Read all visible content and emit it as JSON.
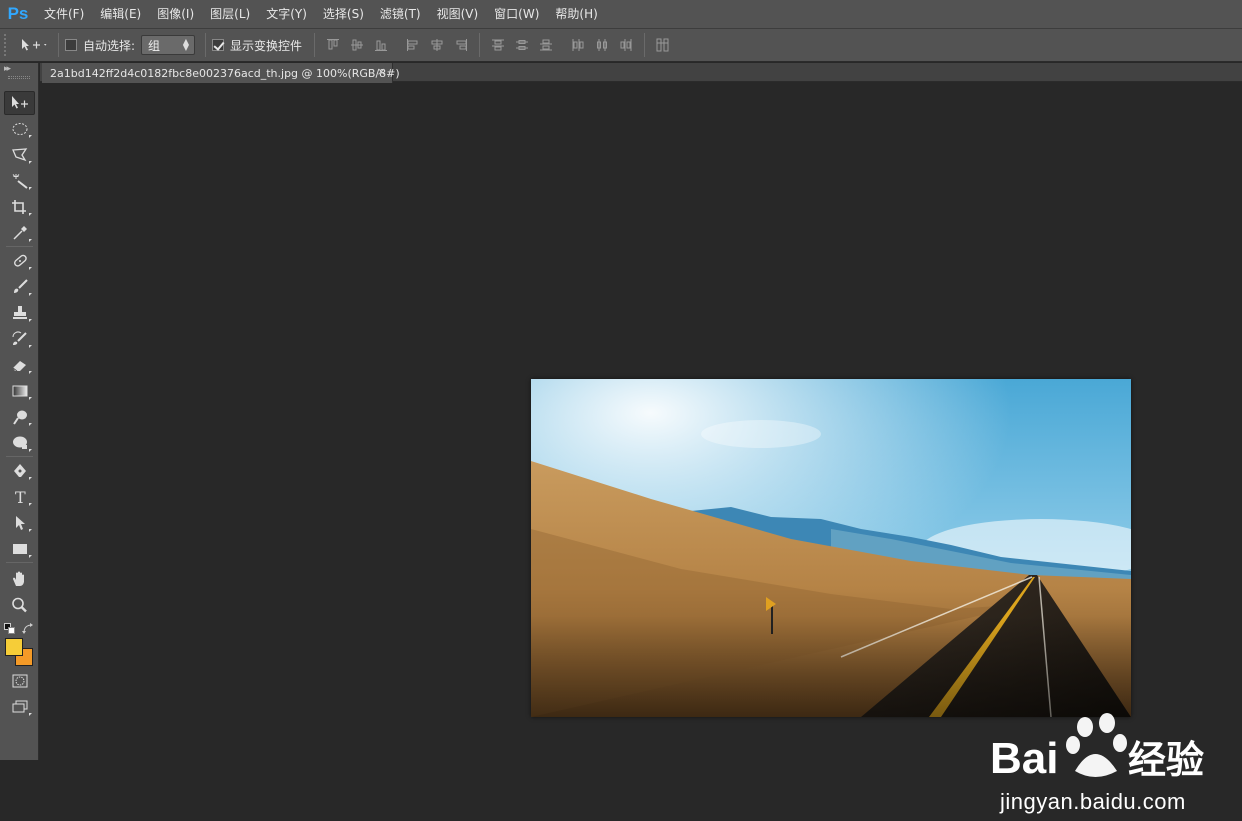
{
  "app": {
    "logo_text": "Ps",
    "accent": "#31a8ff"
  },
  "menu": {
    "items": [
      "文件(F)",
      "编辑(E)",
      "图像(I)",
      "图层(L)",
      "文字(Y)",
      "选择(S)",
      "滤镜(T)",
      "视图(V)",
      "窗口(W)",
      "帮助(H)"
    ]
  },
  "options": {
    "auto_select_label": "自动选择:",
    "auto_select_checked": false,
    "group_value": "组",
    "show_transform_label": "显示变换控件",
    "show_transform_checked": true
  },
  "document": {
    "tab_title": "2a1bd142ff2d4c0182fbc8e002376acd_th.jpg @ 100%(RGB/8#)",
    "close_symbol": "×"
  },
  "colors": {
    "foreground": "#f6cd38",
    "background": "#f49a27"
  },
  "watermark": {
    "brand": "Bai 经验",
    "url": "jingyan.baidu.com"
  }
}
